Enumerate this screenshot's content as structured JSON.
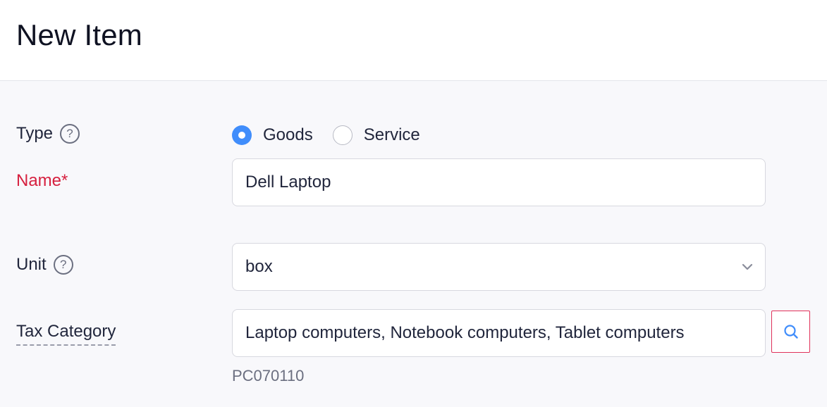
{
  "header": {
    "title": "New Item"
  },
  "form": {
    "type": {
      "label": "Type",
      "help": "?",
      "options": [
        {
          "label": "Goods",
          "checked": true
        },
        {
          "label": "Service",
          "checked": false
        }
      ]
    },
    "name": {
      "label": "Name*",
      "value": "Dell Laptop"
    },
    "unit": {
      "label": "Unit",
      "help": "?",
      "value": "box"
    },
    "tax_category": {
      "label": "Tax Category",
      "value": "Laptop computers, Notebook computers, Tablet computers",
      "code": "PC070110"
    }
  },
  "icons": {
    "help": "question-circle-icon",
    "select": "chevron-down-icon",
    "search": "search-icon"
  },
  "colors": {
    "accent": "#408dfb",
    "required": "#d6203f",
    "search_border": "#e0315a"
  }
}
